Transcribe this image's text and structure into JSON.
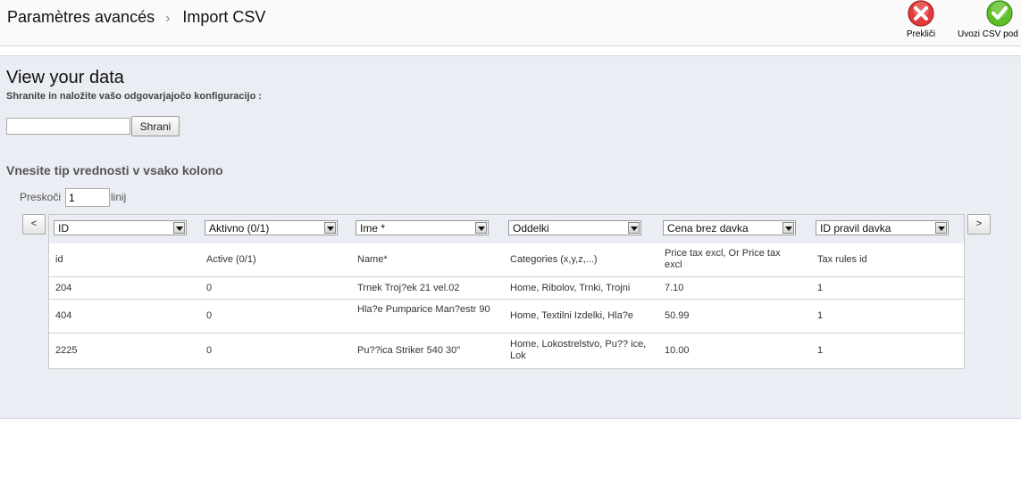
{
  "breadcrumb": {
    "parent": "Paramètres avancés",
    "separator": "›",
    "current": "Import CSV"
  },
  "toolbar": {
    "cancel_label": "Prekliči",
    "import_label": "Uvozi CSV pod"
  },
  "main": {
    "title": "View your data",
    "subtitle": "Shranite in naložite vašo odgovarjajočo konfiguracijo :",
    "config_value": "",
    "save_label": "Shrani",
    "section_title": "Vnesite tip vrednosti v vsako kolono",
    "skip_label": "Preskoči",
    "skip_value": "1",
    "skip_unit": "linij",
    "prev_label": "<",
    "next_label": ">"
  },
  "table": {
    "selects": [
      "ID",
      "Aktivno (0/1)",
      "Ime *",
      "Oddelki",
      "Cena brez davka",
      "ID pravil davka"
    ],
    "headers": [
      "id",
      "Active (0/1)",
      "Name*",
      "Categories (x,y,z,...)",
      "Price tax excl, Or Price tax excl",
      "Tax rules id"
    ],
    "rows": [
      [
        "204",
        "0",
        "Trnek Troj?ek 21 vel.02",
        "Home, Ribolov, Trnki, Trojni",
        "7.10",
        "1"
      ],
      [
        "404",
        "0",
        "Hla?e Pumparice Man?estr 90",
        "Home, Textilni Izdelki, Hla?e",
        "50.99",
        "1"
      ],
      [
        "2225",
        "0",
        "Pu??ica Striker 540 30\"",
        "Home, Lokostrelstvo, Pu?? ice, Lok",
        "10.00",
        "1"
      ]
    ]
  },
  "colors": {
    "cancel": "#e23b3b",
    "import": "#5fbf2a",
    "panel": "#ebedf4"
  },
  "icons": {
    "cancel": "close-icon",
    "import": "check-icon",
    "separator": "chevron-right-icon"
  }
}
